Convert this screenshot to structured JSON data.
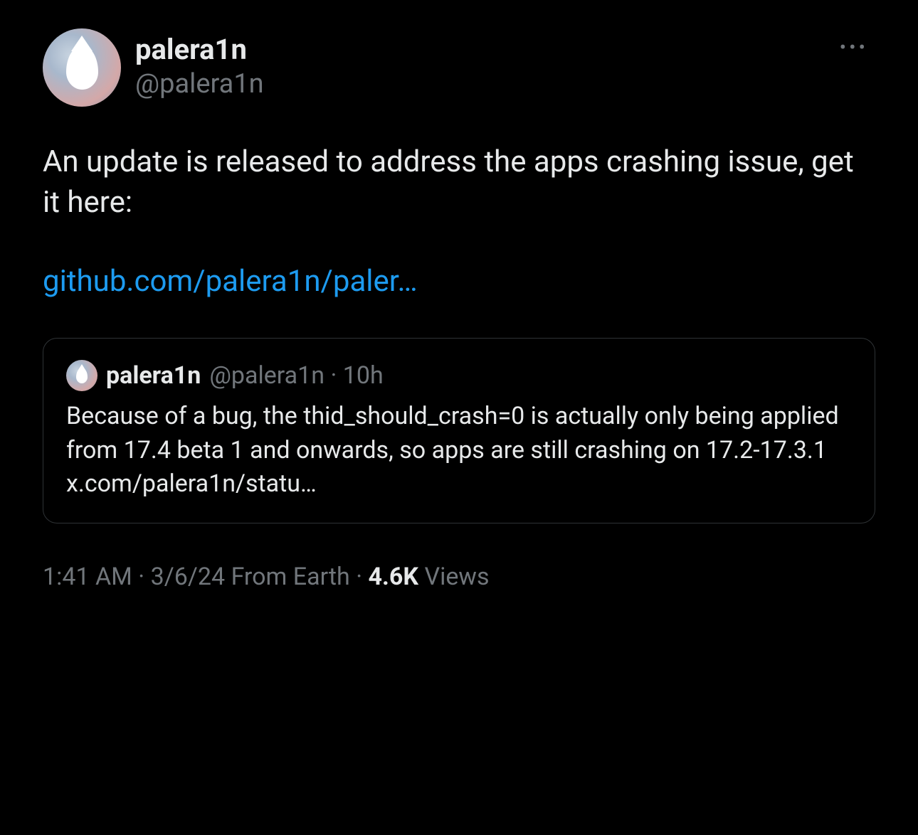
{
  "tweet": {
    "author": {
      "display_name": "palera1n",
      "handle": "@palera1n"
    },
    "body_text": "An update is released to address the apps crashing issue, get it here:",
    "link_text": "github.com/palera1n/paler…",
    "quoted": {
      "author": {
        "display_name": "palera1n",
        "handle": "@palera1n"
      },
      "time": "10h",
      "separator": "·",
      "body": "Because of a bug, the thid_should_crash=0 is actually only being applied from 17.4 beta 1 and onwards, so apps are still crashing on 17.2-17.3.1 x.com/palera1n/statu…"
    },
    "footer": {
      "time": "1:41 AM",
      "date": "3/6/24",
      "location": "From Earth",
      "views_count": "4.6K",
      "views_label": "Views",
      "separator": "·"
    }
  }
}
